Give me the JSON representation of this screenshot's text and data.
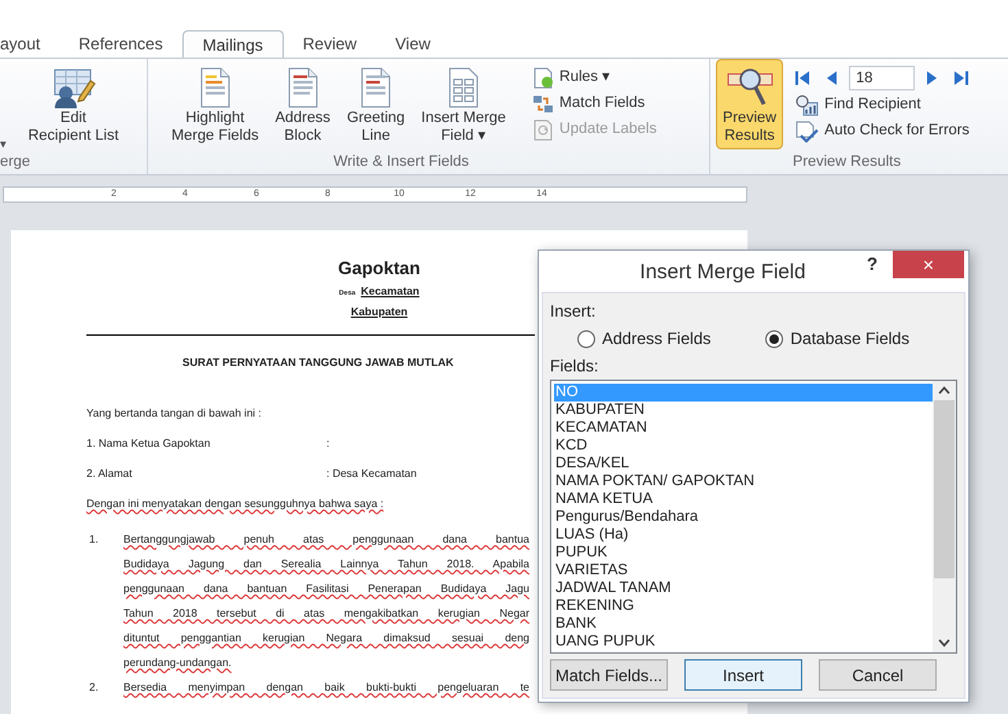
{
  "tabs": [
    {
      "label": "ayout",
      "selected": false
    },
    {
      "label": "References",
      "selected": false
    },
    {
      "label": "Mailings",
      "selected": true
    },
    {
      "label": "Review",
      "selected": false
    },
    {
      "label": "View",
      "selected": false
    }
  ],
  "ribbon": {
    "groups": [
      {
        "label": "erge",
        "cut_arrow": "▾",
        "large": [
          {
            "lines": [
              "Edit",
              "Recipient List"
            ],
            "selected": false
          }
        ]
      },
      {
        "label": "Write & Insert Fields",
        "large": [
          {
            "lines": [
              "Highlight",
              "Merge Fields"
            ],
            "selected": false
          },
          {
            "lines": [
              "Address",
              "Block"
            ],
            "selected": false
          },
          {
            "lines": [
              "Greeting",
              "Line"
            ],
            "selected": false
          },
          {
            "lines": [
              "Insert Merge",
              "Field ▾"
            ],
            "selected": false
          }
        ],
        "small": [
          {
            "label": "Rules ▾",
            "disabled": false
          },
          {
            "label": "Match Fields",
            "disabled": false
          },
          {
            "label": "Update Labels",
            "disabled": true
          }
        ]
      },
      {
        "label": "Preview Results",
        "large": [
          {
            "lines": [
              "Preview",
              "Results"
            ],
            "selected": true
          }
        ],
        "record": "18",
        "small": [
          {
            "label": "Find Recipient",
            "disabled": false
          },
          {
            "label": "Auto Check for Errors",
            "disabled": false
          }
        ]
      }
    ]
  },
  "ruler": {
    "numbers": [
      "2",
      "4",
      "6",
      "8",
      "10",
      "12",
      "14"
    ]
  },
  "document": {
    "title": "Gapoktan",
    "place_line": [
      "Desa",
      "Kecamatan"
    ],
    "region": "Kabupaten",
    "heading": "SURAT PERNYATAAN TANGGUNG JAWAB MUTLAK",
    "intro": "Yang bertanda tangan di bawah ini :",
    "fields": [
      {
        "label": "1.  Nama Ketua Gapoktan",
        "value": ":"
      },
      {
        "label": "2. Alamat",
        "value": ": Desa  Kecamatan"
      }
    ],
    "statement": "Dengan ini menyatakan dengan sesungguhnya bahwa saya :",
    "items": [
      {
        "number": "1.",
        "lines": [
          "Bertanggungjawab  penuh  atas  penggunaan  dana  bantua",
          "Budidaya  Jagung  dan  Serealia  Lainnya  Tahun  2018.  Apabila",
          "penggunaan dana bantuan Fasilitasi Penerapan Budidaya Jagu",
          "Tahun 2018 tersebut di atas mengakibatkan kerugian Negar",
          "dituntut penggantian kerugian Negara dimaksud sesuai deng"
        ],
        "last_line": "perundang-undangan."
      },
      {
        "number": "2.",
        "lines": [
          "Bersedia menyimpan dengan baik bukti-bukti pengeluaran te"
        ]
      }
    ]
  },
  "dialog": {
    "title": "Insert Merge Field",
    "help": "?",
    "close": "×",
    "insert_label": "Insert:",
    "options": [
      {
        "label": "Address Fields",
        "selected": false
      },
      {
        "label": "Database Fields",
        "selected": true
      }
    ],
    "fields_label": "Fields:",
    "fields": [
      {
        "label": "NO",
        "selected": true
      },
      {
        "label": "KABUPATEN",
        "selected": false
      },
      {
        "label": "KECAMATAN",
        "selected": false
      },
      {
        "label": "KCD",
        "selected": false
      },
      {
        "label": "DESA/KEL",
        "selected": false
      },
      {
        "label": "NAMA POKTAN/ GAPOKTAN",
        "selected": false
      },
      {
        "label": "NAMA KETUA",
        "selected": false
      },
      {
        "label": "Pengurus/Bendahara",
        "selected": false
      },
      {
        "label": "LUAS (Ha)",
        "selected": false
      },
      {
        "label": "PUPUK",
        "selected": false
      },
      {
        "label": "VARIETAS",
        "selected": false
      },
      {
        "label": "JADWAL TANAM",
        "selected": false
      },
      {
        "label": "REKENING",
        "selected": false
      },
      {
        "label": "BANK",
        "selected": false
      },
      {
        "label": "UANG PUPUK",
        "selected": false
      }
    ],
    "buttons": [
      {
        "label": "Match Fields...",
        "default": false
      },
      {
        "label": "Insert",
        "default": true
      },
      {
        "label": "Cancel",
        "default": false
      }
    ]
  }
}
